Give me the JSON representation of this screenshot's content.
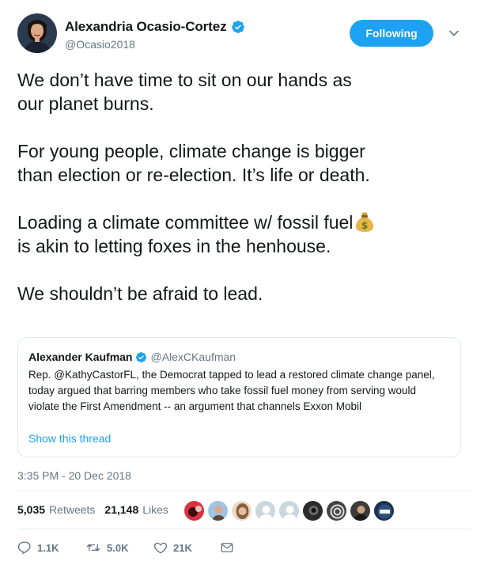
{
  "author": {
    "display_name": "Alexandria Ocasio-Cortez",
    "handle": "@Ocasio2018",
    "verified": true,
    "avatar_icon": "profile-photo"
  },
  "follow_button": {
    "label": "Following",
    "color": "#1da1f2"
  },
  "tweet": {
    "paragraphs": [
      {
        "lines": [
          "We don’t have time to sit on our hands as",
          "our planet burns."
        ]
      },
      {
        "lines": [
          "For young people, climate change is bigger",
          "than election or re-election. It’s life or death."
        ]
      },
      {
        "lines": [
          "Loading a climate committee w/ fossil fuel",
          "is akin to letting foxes in the henhouse."
        ],
        "emoji_after_line": 0,
        "emoji": "money-bag-emoji"
      },
      {
        "lines": [
          "We shouldn’t be afraid to lead."
        ]
      }
    ]
  },
  "quoted_tweet": {
    "display_name": "Alexander Kaufman",
    "handle": "@AlexCKaufman",
    "verified": true,
    "lines": [
      "Rep. @KathyCastorFL, the Democrat tapped to lead a restored climate change panel,",
      "today argued that barring members who take fossil fuel money from serving would",
      "violate the First Amendment -- an argument that channels Exxon Mobil"
    ],
    "show_thread_label": "Show this thread"
  },
  "timestamp": "3:35 PM - 20 Dec 2018",
  "stats": {
    "retweets_count": "5,035",
    "retweets_label": "Retweets",
    "likes_count": "21,148",
    "likes_label": "Likes"
  },
  "likers": [
    {
      "icon": "liker-avatar-1",
      "color": "#d9333f"
    },
    {
      "icon": "liker-avatar-2",
      "color": "#8fb2d6"
    },
    {
      "icon": "liker-avatar-3",
      "color": "#c9a27e"
    },
    {
      "icon": "liker-avatar-4",
      "color": "#ccd6dd"
    },
    {
      "icon": "liker-avatar-5",
      "color": "#ccd6dd"
    },
    {
      "icon": "liker-avatar-6",
      "color": "#2b2b2b"
    },
    {
      "icon": "liker-avatar-7",
      "color": "#555555"
    },
    {
      "icon": "liker-avatar-8",
      "color": "#3b3b3b"
    },
    {
      "icon": "liker-avatar-9",
      "color": "#1e3250"
    }
  ],
  "actions": {
    "reply_count": "1.1K",
    "retweet_count": "5.0K",
    "like_count": "21K",
    "icons": [
      "reply-icon",
      "retweet-icon",
      "heart-icon",
      "direct-message-icon"
    ]
  },
  "colors": {
    "accent": "#1da1f2",
    "text": "#14171a",
    "secondary": "#657786",
    "border": "#e1e8ed"
  }
}
